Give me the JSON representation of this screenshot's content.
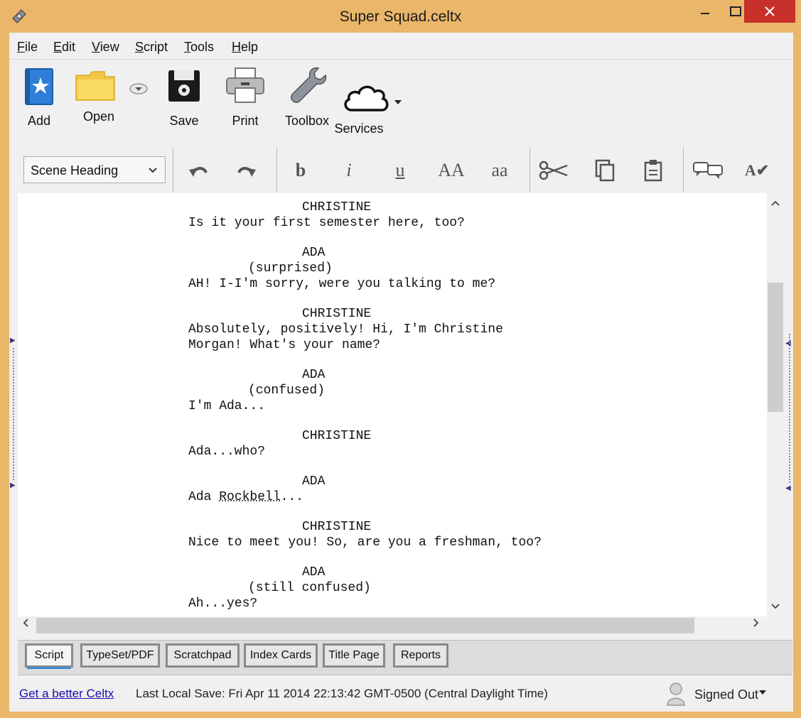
{
  "window": {
    "title": "Super Squad.celtx"
  },
  "menubar": {
    "items": [
      {
        "label": "File",
        "accel": "F",
        "rest": "ile"
      },
      {
        "label": "Edit",
        "accel": "E",
        "rest": "dit"
      },
      {
        "label": "View",
        "accel": "V",
        "rest": "iew"
      },
      {
        "label": "Script",
        "accel": "S",
        "rest": "cript"
      },
      {
        "label": "Tools",
        "accel": "T",
        "rest": "ools"
      },
      {
        "label": "Help",
        "accel": "H",
        "rest": "elp"
      }
    ]
  },
  "toolbar": {
    "add": "Add",
    "open": "Open",
    "save": "Save",
    "print": "Print",
    "toolbox": "Toolbox",
    "services": "Services"
  },
  "format_toolbar": {
    "element_type": "Scene Heading",
    "bold": "b",
    "italic": "i",
    "underline": "u",
    "uppercase": "AA",
    "lowercase": "aa",
    "spellcheck": "A✔"
  },
  "script_lines": [
    {
      "text": "CHRISTINE"
    },
    {
      "text": "Is it your first semester here, too?"
    },
    {
      "text": "ADA"
    },
    {
      "text": "(surprised)"
    },
    {
      "text": "AH! I-I'm sorry, were you talking to me?"
    },
    {
      "text": "CHRISTINE"
    },
    {
      "text": "Absolutely, positively! Hi, I'm Christine"
    },
    {
      "text": "Morgan! What's your name?"
    },
    {
      "text": "ADA"
    },
    {
      "text": "(confused)"
    },
    {
      "text": "I'm Ada..."
    },
    {
      "text": "CHRISTINE"
    },
    {
      "text": "Ada...who?"
    },
    {
      "text": "ADA"
    },
    {
      "text": "Ada ",
      "misspelled": "Rockbell",
      "after": "..."
    },
    {
      "text": "CHRISTINE"
    },
    {
      "text": "Nice to meet you! So, are you a freshman, too?"
    },
    {
      "text": "ADA"
    },
    {
      "text": "(still confused)"
    },
    {
      "text": "Ah...yes?"
    }
  ],
  "tabs": [
    {
      "label": "Script",
      "active": true
    },
    {
      "label": "TypeSet/PDF"
    },
    {
      "label": "Scratchpad"
    },
    {
      "label": "Index Cards"
    },
    {
      "label": "Title Page"
    },
    {
      "label": "Reports"
    }
  ],
  "status": {
    "link": "Get a better Celtx",
    "last_save": "Last Local Save: Fri Apr 11 2014 22:13:42 GMT-0500 (Central Daylight Time)",
    "account": "Signed Out"
  },
  "colors": {
    "window_frame": "#e9b66a",
    "close_button": "#c7312a",
    "link": "#1a0dab",
    "active_tab_indicator": "#3a8bd6"
  }
}
